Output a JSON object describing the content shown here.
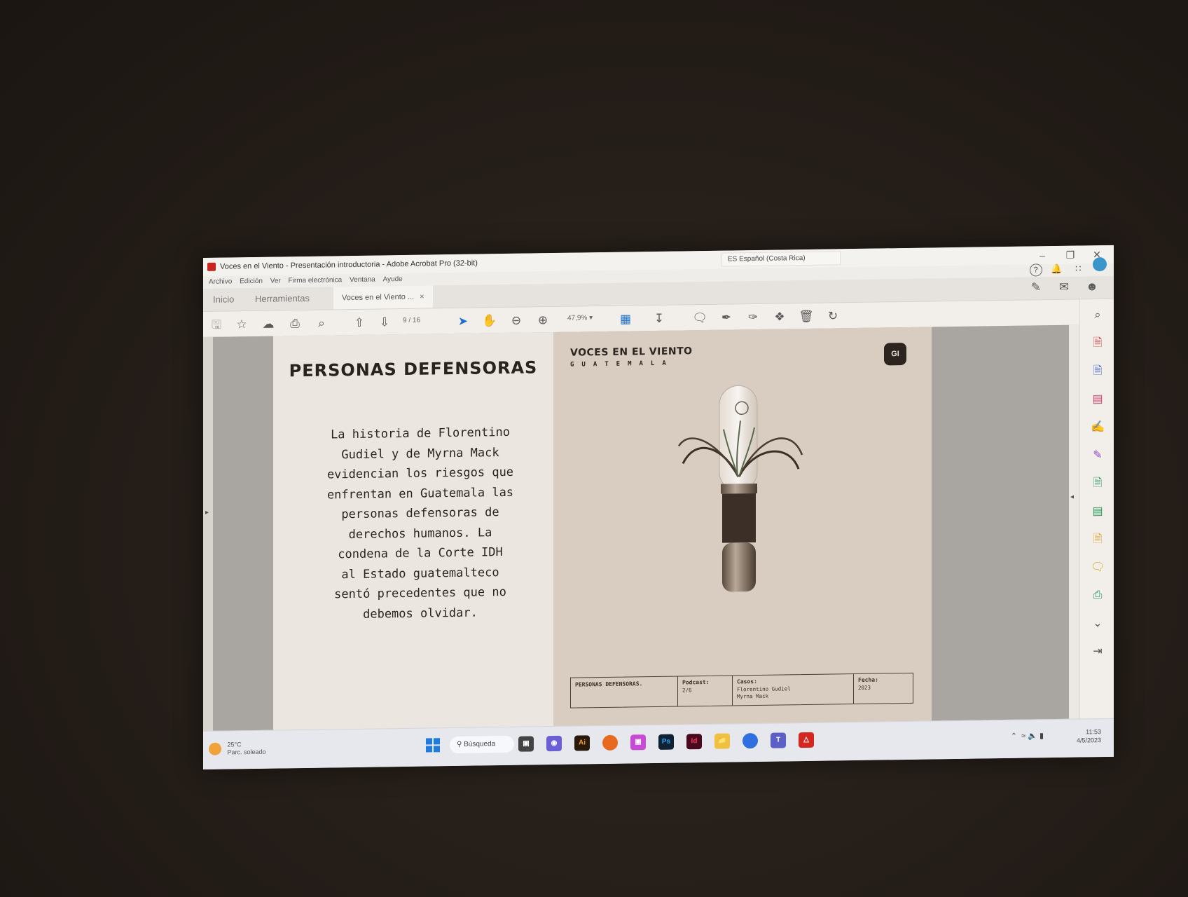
{
  "window": {
    "title": "Voces en el Viento - Presentación introductoria - Adobe Acrobat Pro (32-bit)",
    "language_indicator": "ES Español (Costa Rica)",
    "controls": {
      "minimize": "–",
      "maximize": "❐",
      "close": "✕"
    }
  },
  "menu": [
    "Archivo",
    "Edición",
    "Ver",
    "Firma electrónica",
    "Ventana",
    "Ayude"
  ],
  "tabs": {
    "home": "Inicio",
    "tools": "Herramientas",
    "document": "Voces en el Viento ...",
    "close": "×"
  },
  "toolbar": {
    "page_current": "9",
    "page_total": "/ 16",
    "zoom": "47,9%"
  },
  "slide": {
    "heading": "PERSONAS DEFENSORAS",
    "body": "La historia de Florentino\nGudiel y de Myrna Mack\nevidencian los riesgos que\nenfrentan en Guatemala las\npersonas defensoras de\nderechos humanos. La\ncondena  de la Corte IDH\nal Estado guatemalteco\nsentó precedentes que no\ndebemos olvidar.",
    "brand_title": "VOCES EN EL VIENTO",
    "brand_subtitle": "GUATEMALA",
    "badge": "GI",
    "table": {
      "topic": "PERSONAS DEFENSORAS.",
      "podcast_label": "Podcast:",
      "podcast_value": "2/6",
      "cases_label": "Casos:",
      "cases_value": "Florentino Gudiel\nMyrna Mack",
      "date_label": "Fecha:",
      "date_value": "2023"
    }
  },
  "taskbar": {
    "weather_temp": "25°C",
    "weather_desc": "Parc. soleado",
    "search": "Búsqueda",
    "apps": [
      {
        "name": "Ai",
        "color": "#2a1a0c"
      },
      {
        "name": "Ps",
        "color": "#0f2233"
      },
      {
        "name": "Id",
        "color": "#4a0a1e"
      }
    ],
    "time": "11:53",
    "date": "4/5/2023"
  }
}
